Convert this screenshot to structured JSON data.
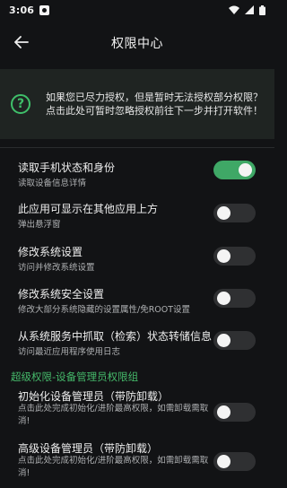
{
  "status_bar": {
    "time": "3:06"
  },
  "header": {
    "title": "权限中心"
  },
  "hint": {
    "icon": "help-icon",
    "text": "如果您已尽力授权，但是暂时无法授权部分权限？点击此处可暂时忽略授权前往下一步并打开软件！"
  },
  "permissions": [
    {
      "title": "读取手机状态和身份",
      "desc": "读取设备信息详情",
      "enabled": true
    },
    {
      "title": "此应用可显示在其他应用上方",
      "desc": "弹出悬浮窗",
      "enabled": false
    },
    {
      "title": "修改系统设置",
      "desc": "访问并修改系统设置",
      "enabled": false
    },
    {
      "title": "修改系统安全设置",
      "desc": "修改大部分系统隐藏的设置属性/免ROOT设置",
      "enabled": false
    },
    {
      "title": "从系统服务中抓取（检索）状态转储信息",
      "desc": "访问最近应用程序使用日志",
      "enabled": false
    }
  ],
  "advanced_section": {
    "header": "超级权限-设备管理员权限组",
    "items": [
      {
        "title": "初始化设备管理员（带防卸载）",
        "desc": "点击此处完成初始化/进阶最高权限，如需卸载需取消!",
        "enabled": false
      },
      {
        "title": "高级设备管理员（带防卸载）",
        "desc": "点击此处完成初始化/进阶最高权限，如需卸载需取消!",
        "enabled": false
      }
    ]
  },
  "colors": {
    "accent": "#3fbf6a",
    "toggle_on": "#3fa866",
    "toggle_off": "#2f3032",
    "background": "#121315"
  }
}
